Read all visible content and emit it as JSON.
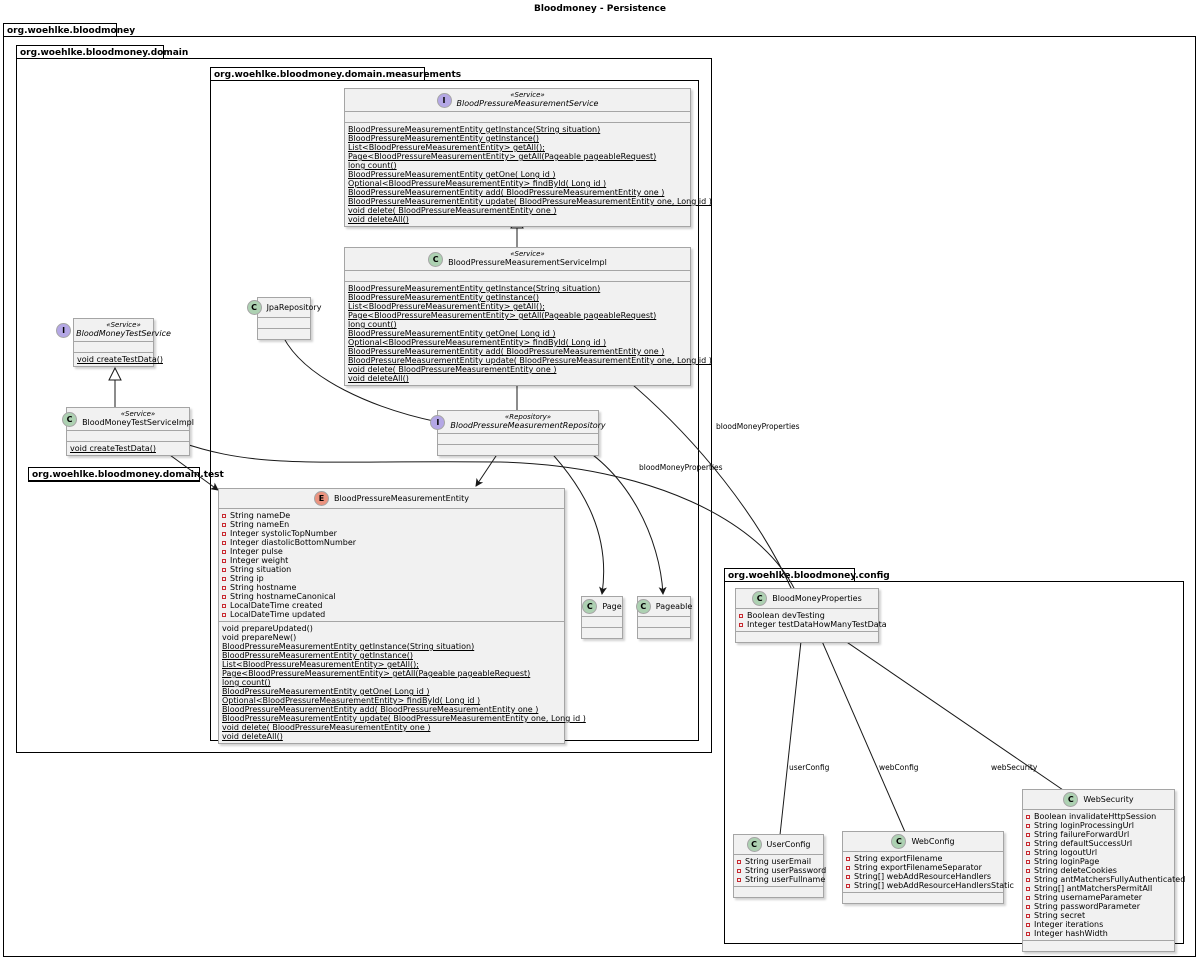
{
  "title": "Bloodmoney - Persistence",
  "packages": {
    "root": "org.woehlke.bloodmoney",
    "domain": "org.woehlke.bloodmoney.domain",
    "measurements": "org.woehlke.bloodmoney.domain.measurements",
    "test": "org.woehlke.bloodmoney.domain.test",
    "config": "org.woehlke.bloodmoney.config"
  },
  "classes": {
    "bpService": {
      "kind": "I",
      "stereotype": "«Service»",
      "name": "BloodPressureMeasurementService",
      "fields": [],
      "methods": [
        "BloodPressureMeasurementEntity getInstance(String situation)",
        "BloodPressureMeasurementEntity getInstance()",
        "List<BloodPressureMeasurementEntity> getAll();",
        "Page<BloodPressureMeasurementEntity> getAll(Pageable pageableRequest)",
        "long count()",
        "BloodPressureMeasurementEntity getOne( Long id )",
        "Optional<BloodPressureMeasurementEntity> findById( Long id )",
        "BloodPressureMeasurementEntity add( BloodPressureMeasurementEntity one )",
        "BloodPressureMeasurementEntity update( BloodPressureMeasurementEntity one, Long id )",
        "void delete( BloodPressureMeasurementEntity one )",
        "void deleteAll()"
      ]
    },
    "bpServiceImpl": {
      "kind": "C",
      "stereotype": "«Service»",
      "name": "BloodPressureMeasurementServiceImpl",
      "fields": [],
      "methods": [
        "BloodPressureMeasurementEntity getInstance(String situation)",
        "BloodPressureMeasurementEntity getInstance()",
        "List<BloodPressureMeasurementEntity> getAll();",
        "Page<BloodPressureMeasurementEntity> getAll(Pageable pageableRequest)",
        "long count()",
        "BloodPressureMeasurementEntity getOne( Long id )",
        "Optional<BloodPressureMeasurementEntity> findById( Long id )",
        "BloodPressureMeasurementEntity add( BloodPressureMeasurementEntity one )",
        "BloodPressureMeasurementEntity update( BloodPressureMeasurementEntity one, Long id )",
        "void delete( BloodPressureMeasurementEntity one )",
        "void deleteAll()"
      ]
    },
    "jpaRepository": {
      "kind": "C",
      "name": "JpaRepository",
      "fields": [],
      "methods": []
    },
    "bpRepository": {
      "kind": "I",
      "stereotype": "«Repository»",
      "name": "BloodPressureMeasurementRepository",
      "fields": [],
      "methods": []
    },
    "bpEntity": {
      "kind": "E",
      "name": "BloodPressureMeasurementEntity",
      "fields": [
        "String nameDe",
        "String nameEn",
        "Integer systolicTopNumber",
        "Integer diastolicBottomNumber",
        "Integer pulse",
        "Integer weight",
        "String situation",
        "String ip",
        "String hostname",
        "String hostnameCanonical",
        "LocalDateTime created",
        "LocalDateTime updated"
      ],
      "methods": [
        "void prepareUpdated()",
        "void prepareNew()",
        "BloodPressureMeasurementEntity getInstance(String situation)",
        "BloodPressureMeasurementEntity getInstance()",
        "List<BloodPressureMeasurementEntity> getAll();",
        "Page<BloodPressureMeasurementEntity> getAll(Pageable pageableRequest)",
        "long count()",
        "BloodPressureMeasurementEntity getOne( Long id )",
        "Optional<BloodPressureMeasurementEntity> findById( Long id )",
        "BloodPressureMeasurementEntity add( BloodPressureMeasurementEntity one )",
        "BloodPressureMeasurementEntity update( BloodPressureMeasurementEntity one, Long id )",
        "void delete( BloodPressureMeasurementEntity one )",
        "void deleteAll()"
      ]
    },
    "page": {
      "kind": "C",
      "name": "Page",
      "fields": [],
      "methods": []
    },
    "pageable": {
      "kind": "C",
      "name": "Pageable",
      "fields": [],
      "methods": []
    },
    "testService": {
      "kind": "I",
      "stereotype": "«Service»",
      "name": "BloodMoneyTestService",
      "fields": [],
      "methods": [
        "void createTestData()"
      ]
    },
    "testServiceImpl": {
      "kind": "C",
      "stereotype": "«Service»",
      "name": "BloodMoneyTestServiceImpl",
      "fields": [],
      "methods": [
        "void createTestData()"
      ]
    },
    "bmProps": {
      "kind": "C",
      "name": "BloodMoneyProperties",
      "fields": [
        "Boolean devTesting",
        "Integer testDataHowManyTestData"
      ],
      "methods": []
    },
    "userConfig": {
      "kind": "C",
      "name": "UserConfig",
      "fields": [
        "String userEmail",
        "String userPassword",
        "String userFullname"
      ],
      "methods": []
    },
    "webConfig": {
      "kind": "C",
      "name": "WebConfig",
      "fields": [
        "String exportFilename",
        "String exportFilenameSeparator",
        "String[] webAddResourceHandlers",
        "String[] webAddResourceHandlersStatic"
      ],
      "methods": []
    },
    "webSecurity": {
      "kind": "C",
      "name": "WebSecurity",
      "fields": [
        "Boolean invalidateHttpSession",
        "String loginProcessingUrl",
        "String failureForwardUrl",
        "String defaultSuccessUrl",
        "String logoutUrl",
        "String loginPage",
        "String deleteCookies",
        "String antMatchersFullyAuthenticated",
        "String[] antMatchersPermitAll",
        "String usernameParameter",
        "String passwordParameter",
        "String secret",
        "Integer iterations",
        "Integer hashWidth"
      ],
      "methods": []
    }
  },
  "link_labels": {
    "svcProps": "bloodMoneyProperties",
    "testProps": "bloodMoneyProperties",
    "userConfig": "userConfig",
    "webConfig": "webConfig",
    "webSecurity": "webSecurity"
  }
}
